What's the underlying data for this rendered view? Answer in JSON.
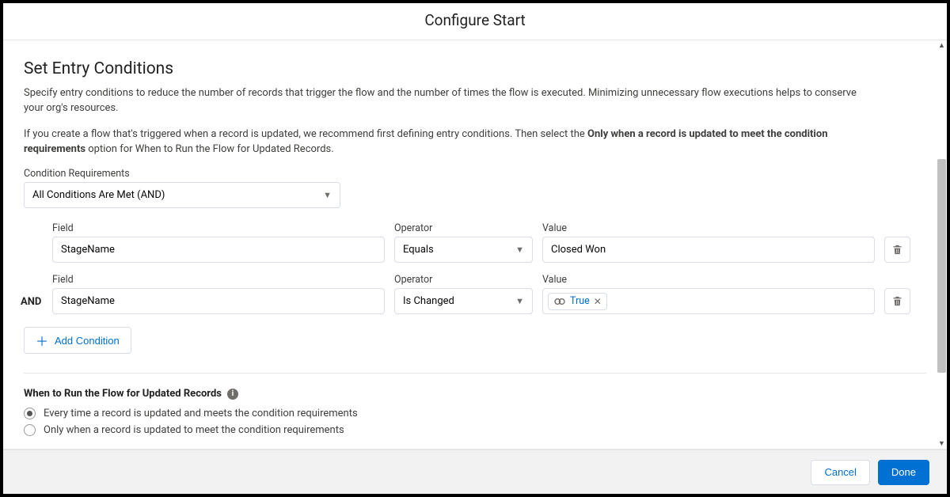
{
  "modal": {
    "title": "Configure Start"
  },
  "section": {
    "title": "Set Entry Conditions",
    "help1": "Specify entry conditions to reduce the number of records that trigger the flow and the number of times the flow is executed. Minimizing unnecessary flow executions helps to conserve your org's resources.",
    "help2_a": "If you create a flow that's triggered when a record is updated, we recommend first defining entry conditions. Then select the ",
    "help2_bold": "Only when a record is updated to meet the condition requirements",
    "help2_b": " option for When to Run the Flow for Updated Records."
  },
  "conditionRequirements": {
    "label": "Condition Requirements",
    "selected": "All Conditions Are Met (AND)"
  },
  "labels": {
    "field": "Field",
    "operator": "Operator",
    "value": "Value",
    "and": "AND"
  },
  "rows": [
    {
      "field": "StageName",
      "operator": "Equals",
      "value": "Closed Won",
      "valueType": "text"
    },
    {
      "field": "StageName",
      "operator": "Is Changed",
      "value": "True",
      "valueType": "pill"
    }
  ],
  "addCondition": "Add Condition",
  "whenToRun": {
    "title": "When to Run the Flow for Updated Records",
    "options": [
      "Every time a record is updated and meets the condition requirements",
      "Only when a record is updated to meet the condition requirements"
    ],
    "selectedIndex": 0
  },
  "footer": {
    "cancel": "Cancel",
    "done": "Done"
  }
}
